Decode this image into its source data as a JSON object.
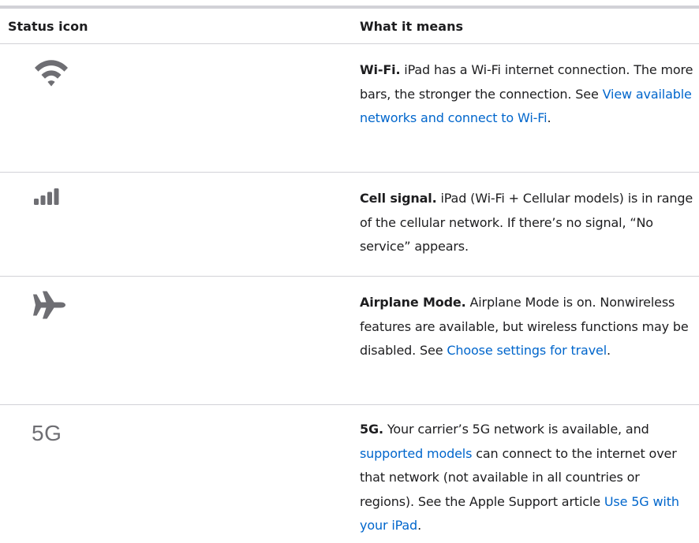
{
  "header": {
    "col_icon": "Status icon",
    "col_meaning": "What it means"
  },
  "rows": [
    {
      "icon": "wifi-icon",
      "title": "Wi-Fi.",
      "text1": " iPad has a Wi-Fi internet connection. The more bars, the stronger the connection. See ",
      "link1": "View available networks and connect to Wi-Fi",
      "text2": "."
    },
    {
      "icon": "cell-signal-icon",
      "title": "Cell signal.",
      "text1": " iPad (Wi-Fi + Cellular models) is in range of the cellular network. If there’s no signal, “No service” appears."
    },
    {
      "icon": "airplane-icon",
      "title": "Airplane Mode.",
      "text1": " Airplane Mode is on. Nonwireless features are available, but wireless functions may be disabled. See ",
      "link1": "Choose settings for travel",
      "text2": "."
    },
    {
      "icon_text": "5G",
      "title": "5G.",
      "text1": " Your carrier’s 5G network is available, and ",
      "link1": "supported models",
      "text2": " can connect to the internet over that network (not available in all countries or regions). See the Apple Support article ",
      "link2": "Use 5G with your iPad",
      "text3": "."
    }
  ],
  "colors": {
    "link": "#0066cc",
    "icon": "#6e6e73",
    "rule": "#d2d2d7",
    "text": "#1d1d1f"
  }
}
